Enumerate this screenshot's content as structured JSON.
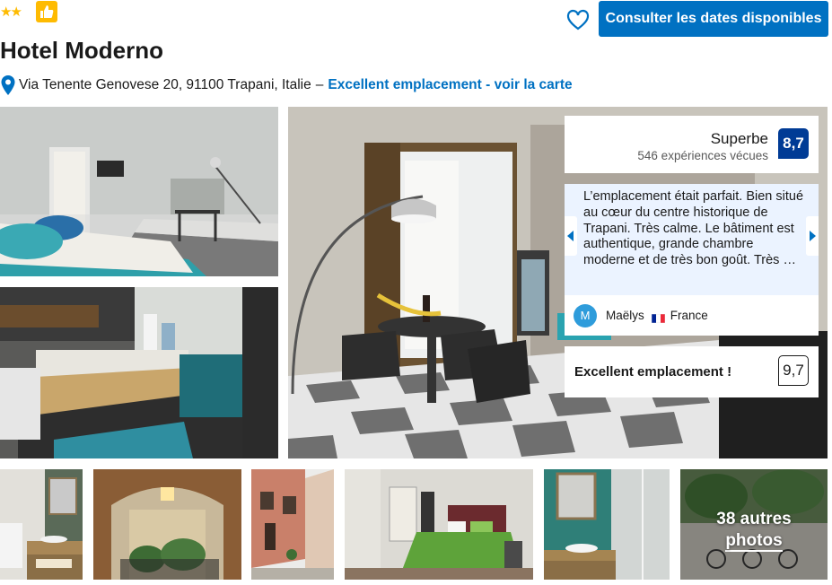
{
  "hotel": {
    "name": "Hotel Moderno",
    "stars": "★★",
    "address": "Via Tenente Genovese 20, 91100 Trapani, Italie",
    "address_separator": "–",
    "location_link": "Excellent emplacement - voir la carte"
  },
  "header": {
    "cta_label": "Consulter les dates disponibles"
  },
  "review_summary": {
    "label": "Superbe",
    "count": "546 expériences vécues",
    "score": "8,7"
  },
  "featured_review": {
    "text": "L’emplacement était parfait. Bien situé au cœur du centre historique de Trapani. Très calme. Le bâtiment est authentique, grande chambre moderne et de très bon goût. Très …",
    "reviewer_initial": "M",
    "reviewer_name": "Maëlys",
    "reviewer_country": "France"
  },
  "location_rating": {
    "label": "Excellent emplacement !",
    "score": "9,7"
  },
  "gallery": {
    "more_photos_line1": "38 autres",
    "more_photos_line2": "photos"
  },
  "colors": {
    "brand_blue": "#0071c2",
    "score_navy": "#003b95",
    "genius_yellow": "#febb02",
    "quote_bg": "#ebf3ff"
  },
  "icons": [
    "star-icon",
    "thumbs-up-icon",
    "heart-icon",
    "map-pin-icon",
    "chevron-left-icon",
    "chevron-right-icon",
    "flag-france-icon"
  ]
}
